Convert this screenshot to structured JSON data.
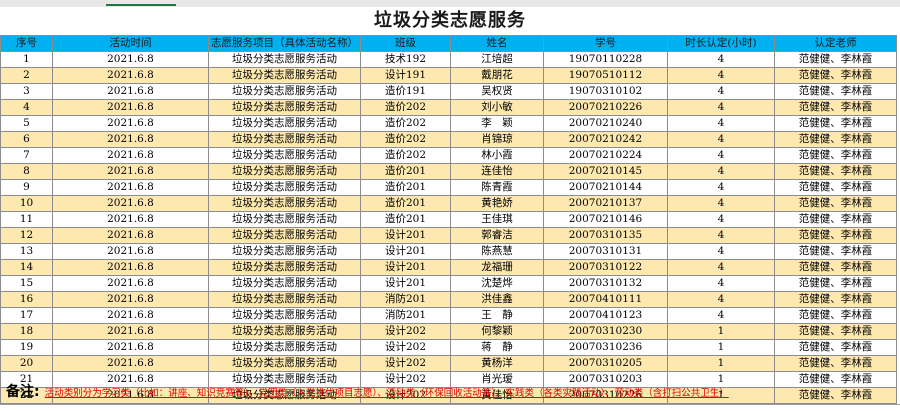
{
  "title": "垃圾分类志愿服务",
  "headers": [
    "序号",
    "活动时间",
    "志愿服务项目（具体活动名称）",
    "班级",
    "姓名",
    "学号",
    "时长认定(小时)",
    "认定老师"
  ],
  "rows": [
    [
      "1",
      "2021.6.8",
      "垃圾分类志愿服务活动",
      "技术192",
      "江培超",
      "19070110228",
      "4",
      "范健健、李林霞"
    ],
    [
      "2",
      "2021.6.8",
      "垃圾分类志愿服务活动",
      "设计191",
      "戴朋花",
      "19070510112",
      "4",
      "范健健、李林霞"
    ],
    [
      "3",
      "2021.6.8",
      "垃圾分类志愿服务活动",
      "造价191",
      "吴权贤",
      "19070310102",
      "4",
      "范健健、李林霞"
    ],
    [
      "4",
      "2021.6.8",
      "垃圾分类志愿服务活动",
      "造价202",
      "刘小敏",
      "20070210226",
      "4",
      "范健健、李林霞"
    ],
    [
      "5",
      "2021.6.8",
      "垃圾分类志愿服务活动",
      "造价202",
      "李　颖",
      "20070210240",
      "4",
      "范健健、李林霞"
    ],
    [
      "6",
      "2021.6.8",
      "垃圾分类志愿服务活动",
      "造价202",
      "肖锦琼",
      "20070210242",
      "4",
      "范健健、李林霞"
    ],
    [
      "7",
      "2021.6.8",
      "垃圾分类志愿服务活动",
      "造价202",
      "林小霞",
      "20070210224",
      "4",
      "范健健、李林霞"
    ],
    [
      "8",
      "2021.6.8",
      "垃圾分类志愿服务活动",
      "造价201",
      "连佳怡",
      "20070210145",
      "4",
      "范健健、李林霞"
    ],
    [
      "9",
      "2021.6.8",
      "垃圾分类志愿服务活动",
      "造价201",
      "陈青霞",
      "20070210144",
      "4",
      "范健健、李林霞"
    ],
    [
      "10",
      "2021.6.8",
      "垃圾分类志愿服务活动",
      "造价201",
      "黄艳娇",
      "20070210137",
      "4",
      "范健健、李林霞"
    ],
    [
      "11",
      "2021.6.8",
      "垃圾分类志愿服务活动",
      "造价201",
      "王佳琪",
      "20070210146",
      "4",
      "范健健、李林霞"
    ],
    [
      "12",
      "2021.6.8",
      "垃圾分类志愿服务活动",
      "设计201",
      "郭睿洁",
      "20070310135",
      "4",
      "范健健、李林霞"
    ],
    [
      "13",
      "2021.6.8",
      "垃圾分类志愿服务活动",
      "设计201",
      "陈燕慧",
      "20070310131",
      "4",
      "范健健、李林霞"
    ],
    [
      "14",
      "2021.6.8",
      "垃圾分类志愿服务活动",
      "设计201",
      "龙福珊",
      "20070310122",
      "4",
      "范健健、李林霞"
    ],
    [
      "15",
      "2021.6.8",
      "垃圾分类志愿服务活动",
      "设计201",
      "沈楚烨",
      "20070310132",
      "4",
      "范健健、李林霞"
    ],
    [
      "16",
      "2021.6.8",
      "垃圾分类志愿服务活动",
      "消防201",
      "洪佳鑫",
      "20070410111",
      "4",
      "范健健、李林霞"
    ],
    [
      "17",
      "2021.6.8",
      "垃圾分类志愿服务活动",
      "消防201",
      "王　静",
      "20070410123",
      "4",
      "范健健、李林霞"
    ],
    [
      "18",
      "2021.6.8",
      "垃圾分类志愿服务活动",
      "设计202",
      "何黎颖",
      "20070310230",
      "1",
      "范健健、李林霞"
    ],
    [
      "19",
      "2021.6.8",
      "垃圾分类志愿服务活动",
      "设计202",
      "蒋　静",
      "20070310236",
      "1",
      "范健健、李林霞"
    ],
    [
      "20",
      "2021.6.8",
      "垃圾分类志愿服务活动",
      "设计202",
      "黄杨洋",
      "20070310205",
      "1",
      "范健健、李林霞"
    ],
    [
      "21",
      "2021.6.8",
      "垃圾分类志愿服务活动",
      "设计202",
      "肖光瑷",
      "20070310203",
      "1",
      "范健健、李林霞"
    ],
    [
      "22",
      "2021.6.8",
      "垃圾分类志愿服务活动",
      "设计202",
      "黄佳怡",
      "20070310226",
      "1",
      "范健健、李林霞"
    ]
  ],
  "note": {
    "label": "备注:",
    "text": "活动类别分为学习类（比如：讲座、知识竞赛等）、党团类（入党推优项目志愿）、活动类（环保回收活动等）、实践类（各类实践活动）、劳动类（含打扫公共卫生）"
  },
  "colors": {
    "header_bg": "#00b0f0",
    "row_alt_bg": "#fde9b0",
    "note_text": "#e00000"
  }
}
